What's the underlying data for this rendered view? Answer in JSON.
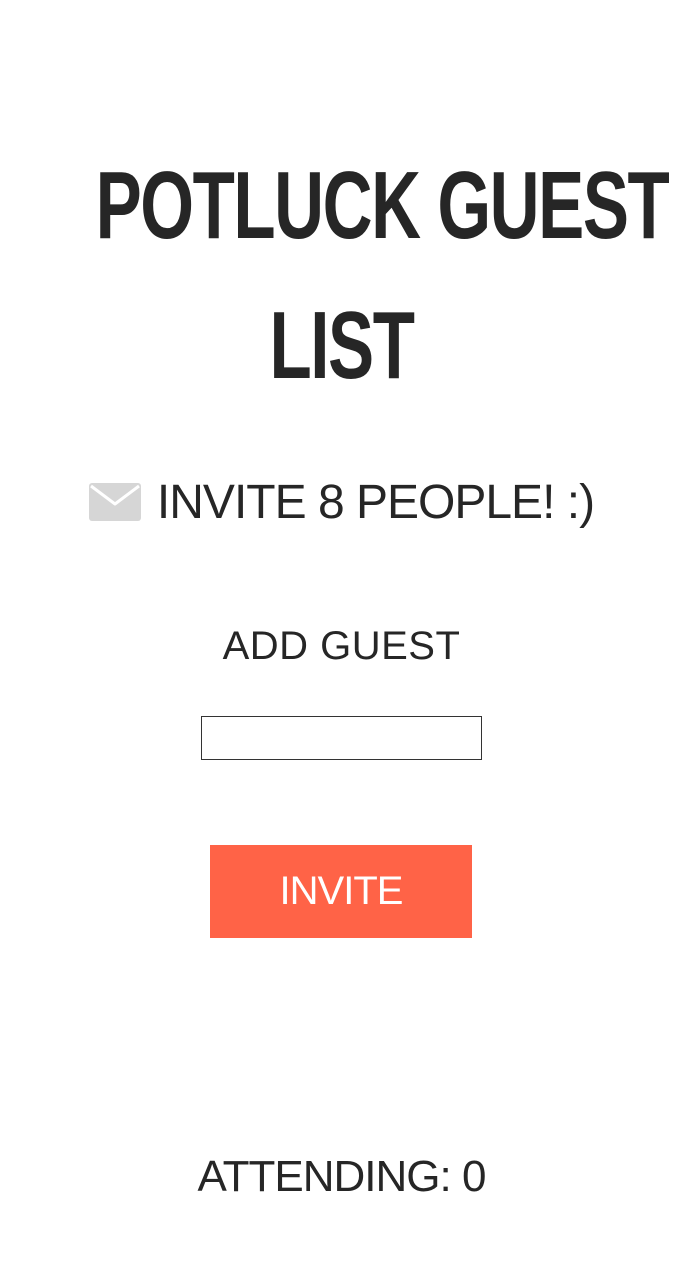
{
  "header": {
    "title_line1": "POTLUCK GUEST",
    "title_line2": "LIST"
  },
  "invite_goal": {
    "icon": "envelope-icon",
    "text": "INVITE 8 PEOPLE! :)"
  },
  "form": {
    "label": "ADD GUEST",
    "input_value": "",
    "input_placeholder": "",
    "button_label": "INVITE"
  },
  "summary": {
    "attending_text": "ATTENDING: 0"
  },
  "colors": {
    "text": "#262626",
    "button_bg": "#ff6347",
    "button_text": "#ffffff",
    "icon": "#d6d6d6"
  }
}
